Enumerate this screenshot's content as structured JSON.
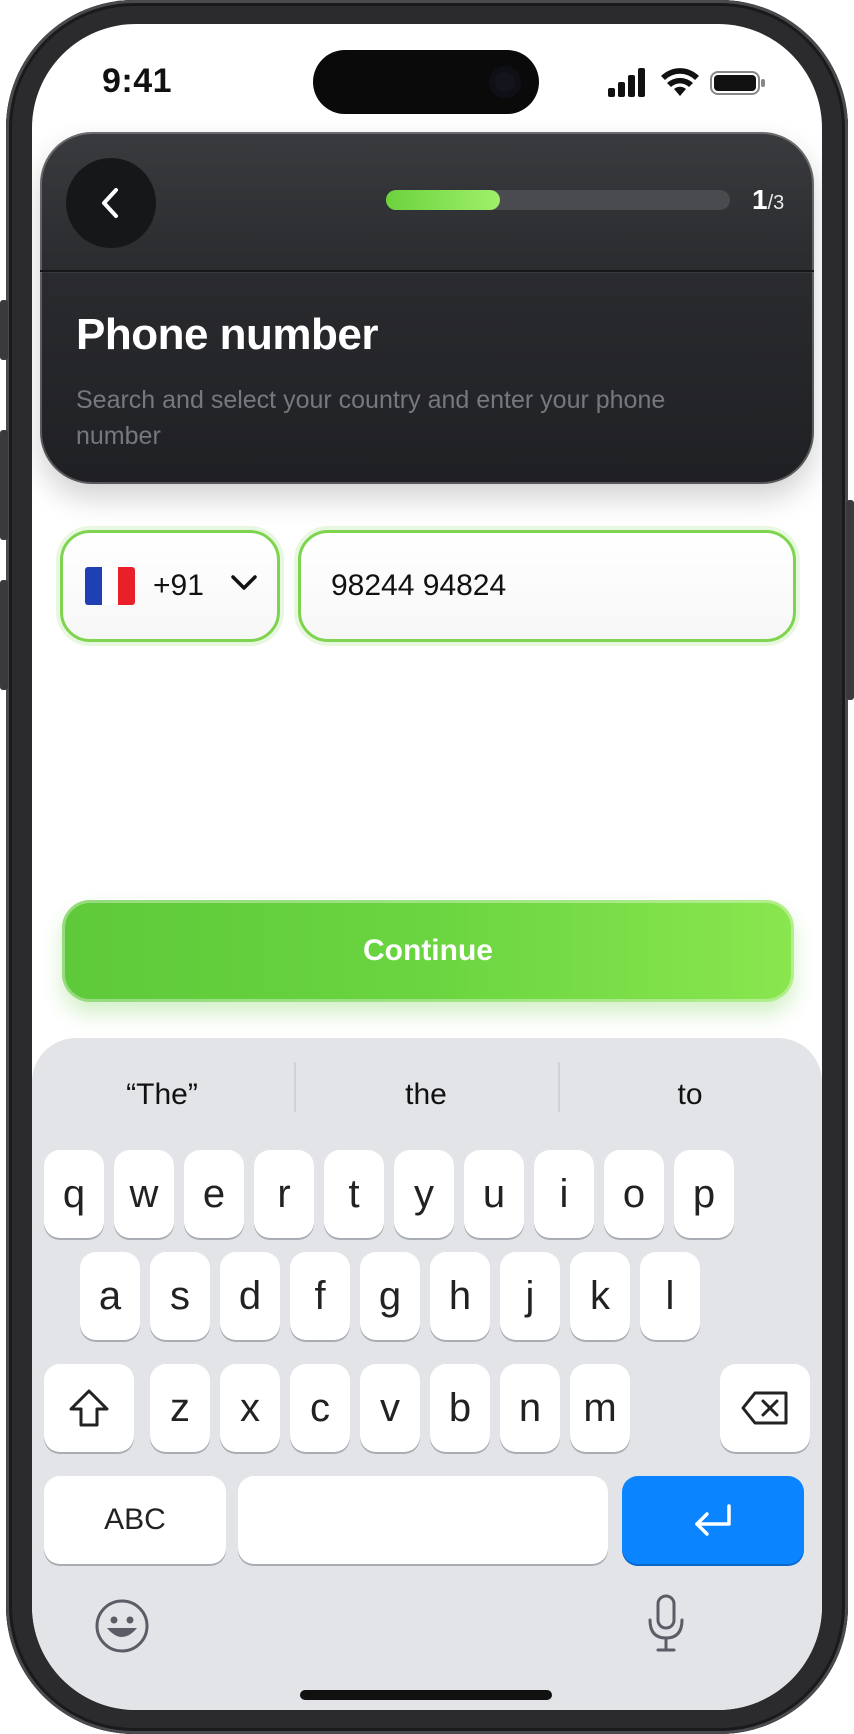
{
  "status_bar": {
    "time": "9:41"
  },
  "header": {
    "progress_current": "1",
    "progress_total": "/3",
    "progress_fraction": 0.33,
    "title": "Phone number",
    "subtitle": "Search and select your country and enter your phone number"
  },
  "form": {
    "country_code": "+91",
    "phone_value": "98244 94824"
  },
  "continue_label": "Continue",
  "keyboard": {
    "suggestions": [
      "“The”",
      "the",
      "to"
    ],
    "row1": [
      "q",
      "w",
      "e",
      "r",
      "t",
      "y",
      "u",
      "i",
      "o",
      "p"
    ],
    "row2": [
      "a",
      "s",
      "d",
      "f",
      "g",
      "h",
      "j",
      "k",
      "l"
    ],
    "row3": [
      "z",
      "x",
      "c",
      "v",
      "b",
      "n",
      "m"
    ],
    "abc_label": "ABC"
  },
  "colors": {
    "accent_green": "#6ad540",
    "return_blue": "#0a84ff",
    "header_dark": "#2a2b2e"
  },
  "icons": {
    "back": "chevron-left-icon",
    "dropdown": "chevron-down-icon",
    "flag": "france-flag-icon",
    "shift": "shift-icon",
    "delete": "backspace-icon",
    "return": "return-icon",
    "emoji": "emoji-icon",
    "mic": "microphone-icon"
  }
}
